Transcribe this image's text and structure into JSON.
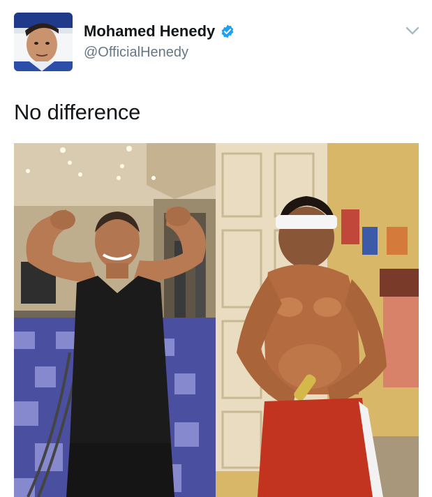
{
  "tweet": {
    "author": {
      "display_name": "Mohamed Henedy",
      "handle": "@OfficialHenedy",
      "verified": true,
      "avatar_icon": "profile-photo"
    },
    "text": "No difference",
    "menu_icon": "chevron-down-icon",
    "media": {
      "panels": [
        {
          "scene": "gym-flex-photo"
        },
        {
          "scene": "room-flex-photo"
        }
      ]
    }
  },
  "colors": {
    "text_primary": "#14171a",
    "text_secondary": "#657786",
    "verified_blue": "#1da1f2",
    "caret_gray": "#aab8c2"
  }
}
